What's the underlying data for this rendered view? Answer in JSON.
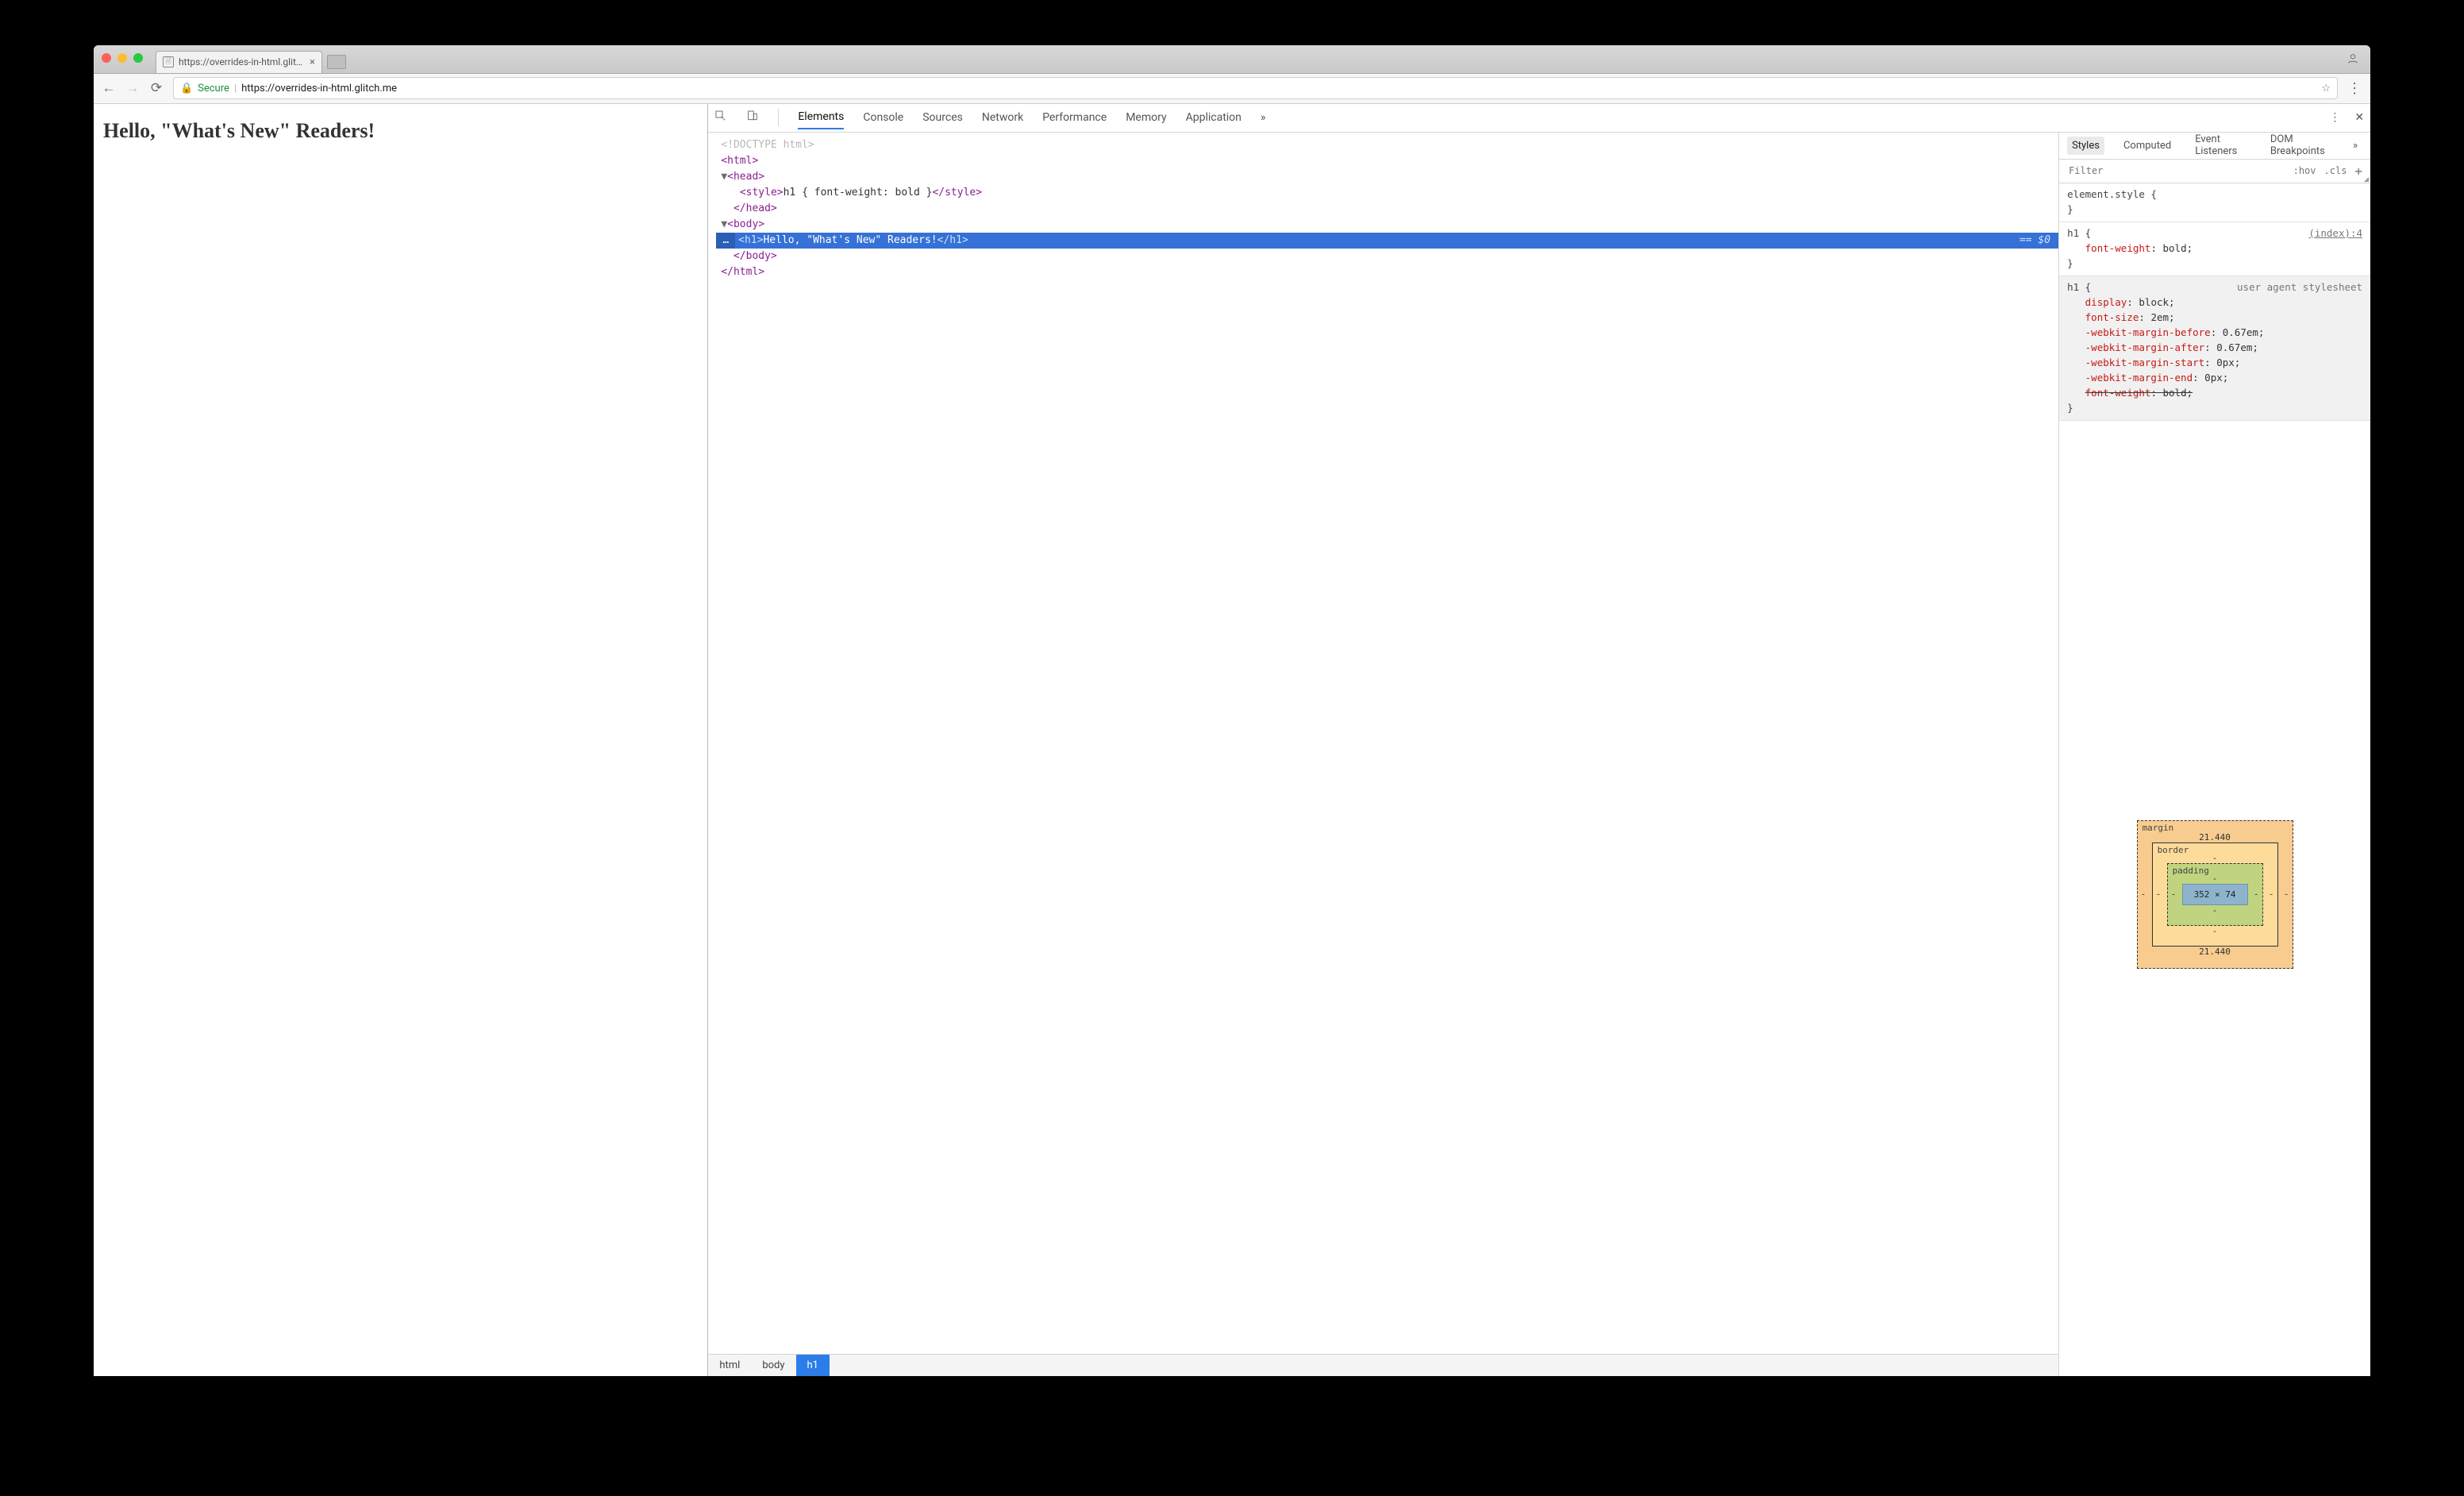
{
  "browser": {
    "tab_title": "https://overrides-in-html.glitch…",
    "secure_label": "Secure",
    "url": "https://overrides-in-html.glitch.me"
  },
  "page": {
    "h1": "Hello, \"What's New\" Readers!"
  },
  "devtools": {
    "tabs": [
      "Elements",
      "Console",
      "Sources",
      "Network",
      "Performance",
      "Memory",
      "Application"
    ],
    "active_tab": "Elements",
    "overflow_glyph": "»",
    "dom": {
      "doctype": "<!DOCTYPE html>",
      "html_open": "html",
      "head_open": "head",
      "style_tag_open": "style",
      "style_text": "h1 { font-weight: bold }",
      "body_open": "body",
      "h1_tag": "h1",
      "h1_text": "Hello, \"What's New\" Readers!",
      "selected_hint": "== $0"
    },
    "crumbs": [
      "html",
      "body",
      "h1"
    ],
    "subtabs": [
      "Styles",
      "Computed",
      "Event Listeners",
      "DOM Breakpoints"
    ],
    "filter_placeholder": "Filter",
    "hov": ":hov",
    "cls": ".cls",
    "rules": {
      "element_style": "element.style {",
      "h1_author": {
        "selector": "h1 {",
        "origin": "(index):4",
        "p1": "font-weight",
        "v1": "bold;"
      },
      "h1_ua": {
        "selector": "h1 {",
        "origin": "user agent stylesheet",
        "props": [
          [
            "display",
            "block;"
          ],
          [
            "font-size",
            "2em;"
          ],
          [
            "-webkit-margin-before",
            "0.67em;"
          ],
          [
            "-webkit-margin-after",
            "0.67em;"
          ],
          [
            "-webkit-margin-start",
            "0px;"
          ],
          [
            "-webkit-margin-end",
            "0px;"
          ]
        ],
        "strike_prop": "font-weight",
        "strike_val": "bold;"
      }
    },
    "boxmodel": {
      "margin_label": "margin",
      "border_label": "border",
      "padding_label": "padding",
      "margin_top": "21.440",
      "margin_bottom": "21.440",
      "margin_left": "-",
      "margin_right": "-",
      "border_all": "-",
      "padding_top": "-",
      "padding_bottom": "-",
      "padding_side": "-",
      "content": "352 × 74"
    }
  }
}
